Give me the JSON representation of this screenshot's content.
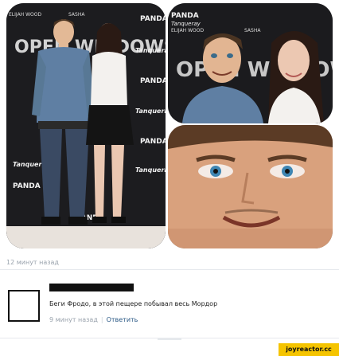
{
  "photos": {
    "main": {
      "left_name": "ELIJAH WOOD",
      "right_name": "SASHA",
      "title_text": "OPEN WINDOWS",
      "sponsors": [
        "PANDA",
        "Tanqueray",
        "PANDA",
        "Tanqueray",
        "PANDA",
        "Tanqueray",
        "PANDA",
        "Tanqueray",
        "PANDA"
      ]
    },
    "top_right": {
      "left_name": "ELIJAH WOOD",
      "right_name": "SASHA",
      "sponsor": "PANDA",
      "brand": "Tanqueray",
      "title_text": "OPEN WINDOWS"
    }
  },
  "post": {
    "timestamp": "12 минут назад"
  },
  "comment": {
    "text": "Беги Фродо, в этой пещере побывал весь Мордор",
    "time": "9 минут назад",
    "separator": "|",
    "reply_label": "Ответить"
  },
  "watermark": "joyreactor.cc"
}
